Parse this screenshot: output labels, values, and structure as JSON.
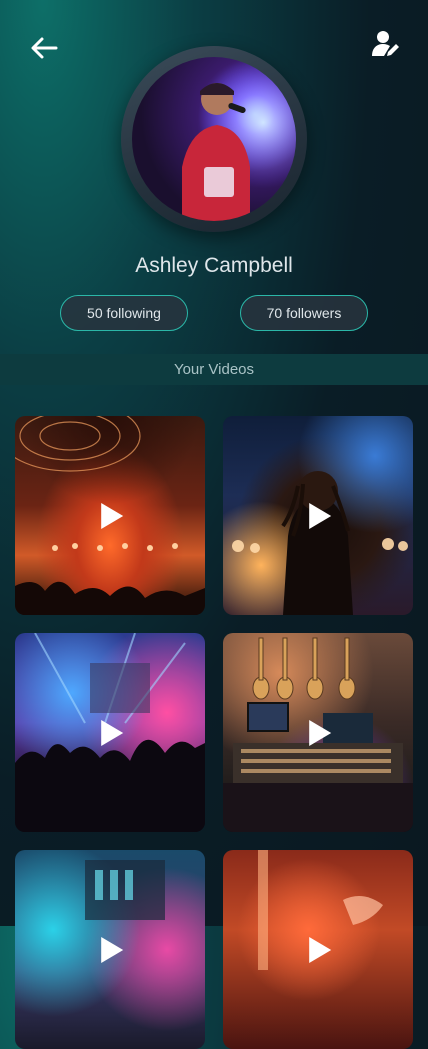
{
  "header": {
    "back_icon": "arrow-left-icon",
    "edit_icon": "user-edit-icon"
  },
  "profile": {
    "name": "Ashley Campbell",
    "following_label": "50 following",
    "followers_label": "70 followers"
  },
  "section": {
    "title": "Your Videos"
  },
  "videos": [
    {
      "id": "concert-crowd-stage-lights"
    },
    {
      "id": "singer-with-dreadlocks"
    },
    {
      "id": "dj-stage-crowd"
    },
    {
      "id": "recording-studio-guitars"
    },
    {
      "id": "neon-mixer"
    },
    {
      "id": "orange-light-performance"
    }
  ],
  "colors": {
    "accent": "#2bb7a8",
    "section_bar": "#0d3b3f",
    "pill_bg": "#28343e"
  }
}
